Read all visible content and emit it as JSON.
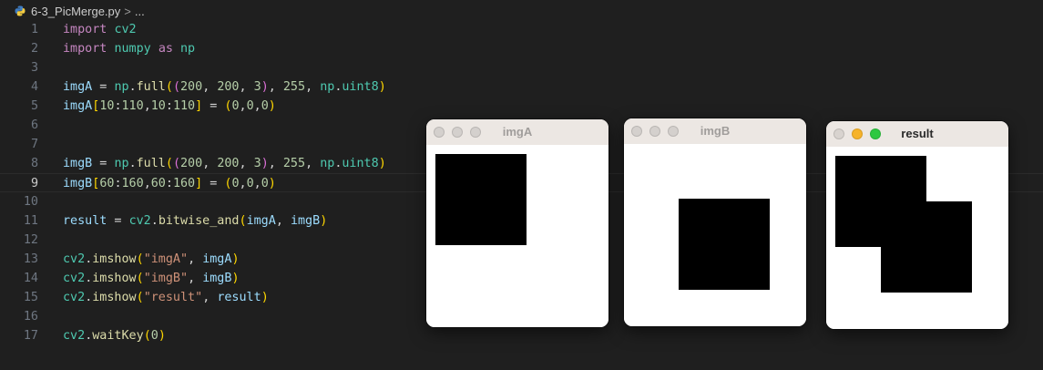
{
  "breadcrumb": {
    "file": "6-3_PicMerge.py",
    "separator": ">",
    "rest": "..."
  },
  "active_line": 9,
  "code_lines": [
    {
      "n": "1",
      "tokens": [
        [
          "kw",
          "import"
        ],
        [
          "op",
          " "
        ],
        [
          "mod",
          "cv2"
        ]
      ]
    },
    {
      "n": "2",
      "tokens": [
        [
          "kw",
          "import"
        ],
        [
          "op",
          " "
        ],
        [
          "mod",
          "numpy"
        ],
        [
          "op",
          " "
        ],
        [
          "kw",
          "as"
        ],
        [
          "op",
          " "
        ],
        [
          "mod",
          "np"
        ]
      ]
    },
    {
      "n": "3",
      "tokens": []
    },
    {
      "n": "4",
      "tokens": [
        [
          "var",
          "imgA"
        ],
        [
          "op",
          " = "
        ],
        [
          "mod",
          "np"
        ],
        [
          "op",
          "."
        ],
        [
          "fn",
          "full"
        ],
        [
          "p1",
          "("
        ],
        [
          "p2",
          "("
        ],
        [
          "num",
          "200"
        ],
        [
          "op",
          ", "
        ],
        [
          "num",
          "200"
        ],
        [
          "op",
          ", "
        ],
        [
          "num",
          "3"
        ],
        [
          "p2",
          ")"
        ],
        [
          "op",
          ", "
        ],
        [
          "num",
          "255"
        ],
        [
          "op",
          ", "
        ],
        [
          "mod",
          "np"
        ],
        [
          "op",
          "."
        ],
        [
          "mod",
          "uint8"
        ],
        [
          "p1",
          ")"
        ]
      ]
    },
    {
      "n": "5",
      "tokens": [
        [
          "var",
          "imgA"
        ],
        [
          "p1",
          "["
        ],
        [
          "num",
          "10"
        ],
        [
          "op",
          ":"
        ],
        [
          "num",
          "110"
        ],
        [
          "op",
          ","
        ],
        [
          "num",
          "10"
        ],
        [
          "op",
          ":"
        ],
        [
          "num",
          "110"
        ],
        [
          "p1",
          "]"
        ],
        [
          "op",
          " = "
        ],
        [
          "p1",
          "("
        ],
        [
          "num",
          "0"
        ],
        [
          "op",
          ","
        ],
        [
          "num",
          "0"
        ],
        [
          "op",
          ","
        ],
        [
          "num",
          "0"
        ],
        [
          "p1",
          ")"
        ]
      ]
    },
    {
      "n": "6",
      "tokens": []
    },
    {
      "n": "7",
      "tokens": []
    },
    {
      "n": "8",
      "tokens": [
        [
          "var",
          "imgB"
        ],
        [
          "op",
          " = "
        ],
        [
          "mod",
          "np"
        ],
        [
          "op",
          "."
        ],
        [
          "fn",
          "full"
        ],
        [
          "p1",
          "("
        ],
        [
          "p2",
          "("
        ],
        [
          "num",
          "200"
        ],
        [
          "op",
          ", "
        ],
        [
          "num",
          "200"
        ],
        [
          "op",
          ", "
        ],
        [
          "num",
          "3"
        ],
        [
          "p2",
          ")"
        ],
        [
          "op",
          ", "
        ],
        [
          "num",
          "255"
        ],
        [
          "op",
          ", "
        ],
        [
          "mod",
          "np"
        ],
        [
          "op",
          "."
        ],
        [
          "mod",
          "uint8"
        ],
        [
          "p1",
          ")"
        ]
      ]
    },
    {
      "n": "9",
      "tokens": [
        [
          "var",
          "imgB"
        ],
        [
          "p1",
          "["
        ],
        [
          "num",
          "60"
        ],
        [
          "op",
          ":"
        ],
        [
          "num",
          "160"
        ],
        [
          "op",
          ","
        ],
        [
          "num",
          "60"
        ],
        [
          "op",
          ":"
        ],
        [
          "num",
          "160"
        ],
        [
          "p1",
          "]"
        ],
        [
          "op",
          " = "
        ],
        [
          "p1",
          "("
        ],
        [
          "num",
          "0"
        ],
        [
          "op",
          ","
        ],
        [
          "num",
          "0"
        ],
        [
          "op",
          ","
        ],
        [
          "num",
          "0"
        ],
        [
          "p1",
          ")"
        ]
      ]
    },
    {
      "n": "10",
      "tokens": []
    },
    {
      "n": "11",
      "tokens": [
        [
          "var",
          "result"
        ],
        [
          "op",
          " = "
        ],
        [
          "mod",
          "cv2"
        ],
        [
          "op",
          "."
        ],
        [
          "fn",
          "bitwise_and"
        ],
        [
          "p1",
          "("
        ],
        [
          "var",
          "imgA"
        ],
        [
          "op",
          ", "
        ],
        [
          "var",
          "imgB"
        ],
        [
          "p1",
          ")"
        ]
      ]
    },
    {
      "n": "12",
      "tokens": []
    },
    {
      "n": "13",
      "tokens": [
        [
          "mod",
          "cv2"
        ],
        [
          "op",
          "."
        ],
        [
          "fn",
          "imshow"
        ],
        [
          "p1",
          "("
        ],
        [
          "str",
          "\"imgA\""
        ],
        [
          "op",
          ", "
        ],
        [
          "var",
          "imgA"
        ],
        [
          "p1",
          ")"
        ]
      ]
    },
    {
      "n": "14",
      "tokens": [
        [
          "mod",
          "cv2"
        ],
        [
          "op",
          "."
        ],
        [
          "fn",
          "imshow"
        ],
        [
          "p1",
          "("
        ],
        [
          "str",
          "\"imgB\""
        ],
        [
          "op",
          ", "
        ],
        [
          "var",
          "imgB"
        ],
        [
          "p1",
          ")"
        ]
      ]
    },
    {
      "n": "15",
      "tokens": [
        [
          "mod",
          "cv2"
        ],
        [
          "op",
          "."
        ],
        [
          "fn",
          "imshow"
        ],
        [
          "p1",
          "("
        ],
        [
          "str",
          "\"result\""
        ],
        [
          "op",
          ", "
        ],
        [
          "var",
          "result"
        ],
        [
          "p1",
          ")"
        ]
      ]
    },
    {
      "n": "16",
      "tokens": []
    },
    {
      "n": "17",
      "tokens": [
        [
          "mod",
          "cv2"
        ],
        [
          "op",
          "."
        ],
        [
          "fn",
          "waitKey"
        ],
        [
          "p1",
          "("
        ],
        [
          "num",
          "0"
        ],
        [
          "p1",
          ")"
        ]
      ]
    }
  ],
  "windows": {
    "imgA": {
      "title": "imgA"
    },
    "imgB": {
      "title": "imgB"
    },
    "result": {
      "title": "result"
    }
  },
  "colors": {
    "editor_bg": "#1f1f1f",
    "keyword": "#c586c0",
    "module": "#4ec9b0",
    "variable": "#9cdcfe",
    "function": "#dcdcaa",
    "number": "#b5cea8",
    "string": "#ce9178",
    "window_bg": "#ffffff",
    "square": "#000000",
    "minimize": "#f6b32a",
    "zoom": "#2ec840"
  }
}
